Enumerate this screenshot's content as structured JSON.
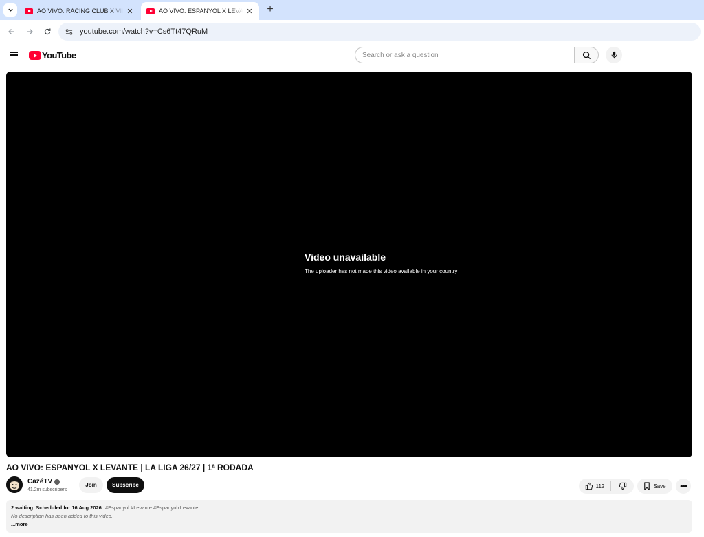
{
  "browser": {
    "tabs": [
      {
        "title": "AO VIVO: RACING CLUB X VILLAREAL",
        "active": false
      },
      {
        "title": "AO VIVO: ESPANYOL X LEVANTE | LA LIGA",
        "active": true
      }
    ],
    "url": "youtube.com/watch?v=Cs6Tt47QRuM"
  },
  "youtube": {
    "logo_text": "YouTube",
    "search_placeholder": "Search or ask a question"
  },
  "player": {
    "error_title": "Video unavailable",
    "error_message": "The uploader has not made this video available in your country"
  },
  "video": {
    "title": "AO VIVO: ESPANYOL X LEVANTE | LA LIGA 26/27 | 1ª RODADA",
    "channel_name": "CazéTV",
    "subscribers": "41.2m subscribers",
    "join_label": "Join",
    "subscribe_label": "Subscribe",
    "likes": "112",
    "save_label": "Save"
  },
  "description": {
    "waiting": "2 waiting",
    "scheduled": "Scheduled for 16 Aug 2026",
    "hashtags": "#Espanyol #Levante #EspanyolxLevante",
    "body": "No description has been added to this video.",
    "more_label": "...more"
  },
  "colors": {
    "brand_red": "#ff0033",
    "tabstrip": "#d3e3fd",
    "omnibox": "#edf2fa"
  }
}
